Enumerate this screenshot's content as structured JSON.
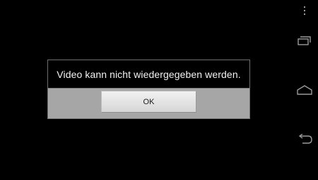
{
  "dialog": {
    "message": "Video kann nicht wiedergegeben werden.",
    "ok_label": "OK"
  },
  "navigation": {
    "overflow_icon": "overflow-menu-icon",
    "recents_icon": "recent-apps-icon",
    "home_icon": "home-icon",
    "back_icon": "back-icon"
  },
  "colors": {
    "background": "#000000",
    "dialog_border": "#6e6e6e",
    "button_bar": "#a6a6a6",
    "nav_icon": "#9a9a9a"
  }
}
